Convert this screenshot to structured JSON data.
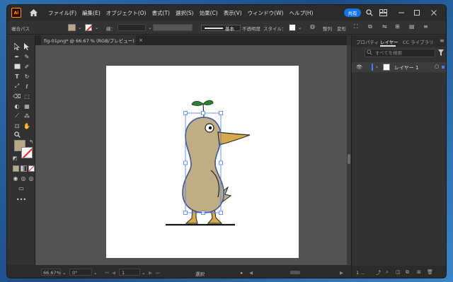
{
  "app": {
    "logo": "Ai",
    "menu": [
      "ファイル(F)",
      "編集(E)",
      "オブジェクト(O)",
      "書式(T)",
      "選択(S)",
      "効果(C)",
      "表示(V)",
      "ウィンドウ(W)",
      "ヘルプ(H)"
    ],
    "share_label": "共有"
  },
  "controlbar": {
    "object_type": "複合パス",
    "stroke_label": "線：",
    "stroke_style": "基本",
    "opacity_label": "不透明度",
    "style_label": "スタイル：",
    "align_label": "整列",
    "transform_label": "変形"
  },
  "document": {
    "tab_title": "fig-01png* @ 66.67 % (RGB/プレビュー)",
    "close_glyph": "×"
  },
  "status": {
    "zoom": "66.67%",
    "rotation": "0°",
    "artboard_number": "1",
    "tool_name": "選択"
  },
  "right_panel": {
    "tabs": [
      "プロパティ",
      "レイヤー",
      "CC ライブラリ"
    ],
    "search_placeholder": "すべてを検索",
    "layer_name": "レイヤー 1",
    "layer_count": "1 ..."
  },
  "colors": {
    "accent": "#1473e6",
    "fill": "#b9a988",
    "selection": "#4a7bff",
    "bird_body": "#bfae85",
    "beak": "#d6a94a",
    "sprout": "#2e7d32"
  },
  "icons": [
    "home-icon",
    "search-icon",
    "arrange-icon",
    "minimize-icon",
    "maximize-icon",
    "close-icon",
    "eye-icon",
    "filter-icon",
    "menu-icon"
  ]
}
